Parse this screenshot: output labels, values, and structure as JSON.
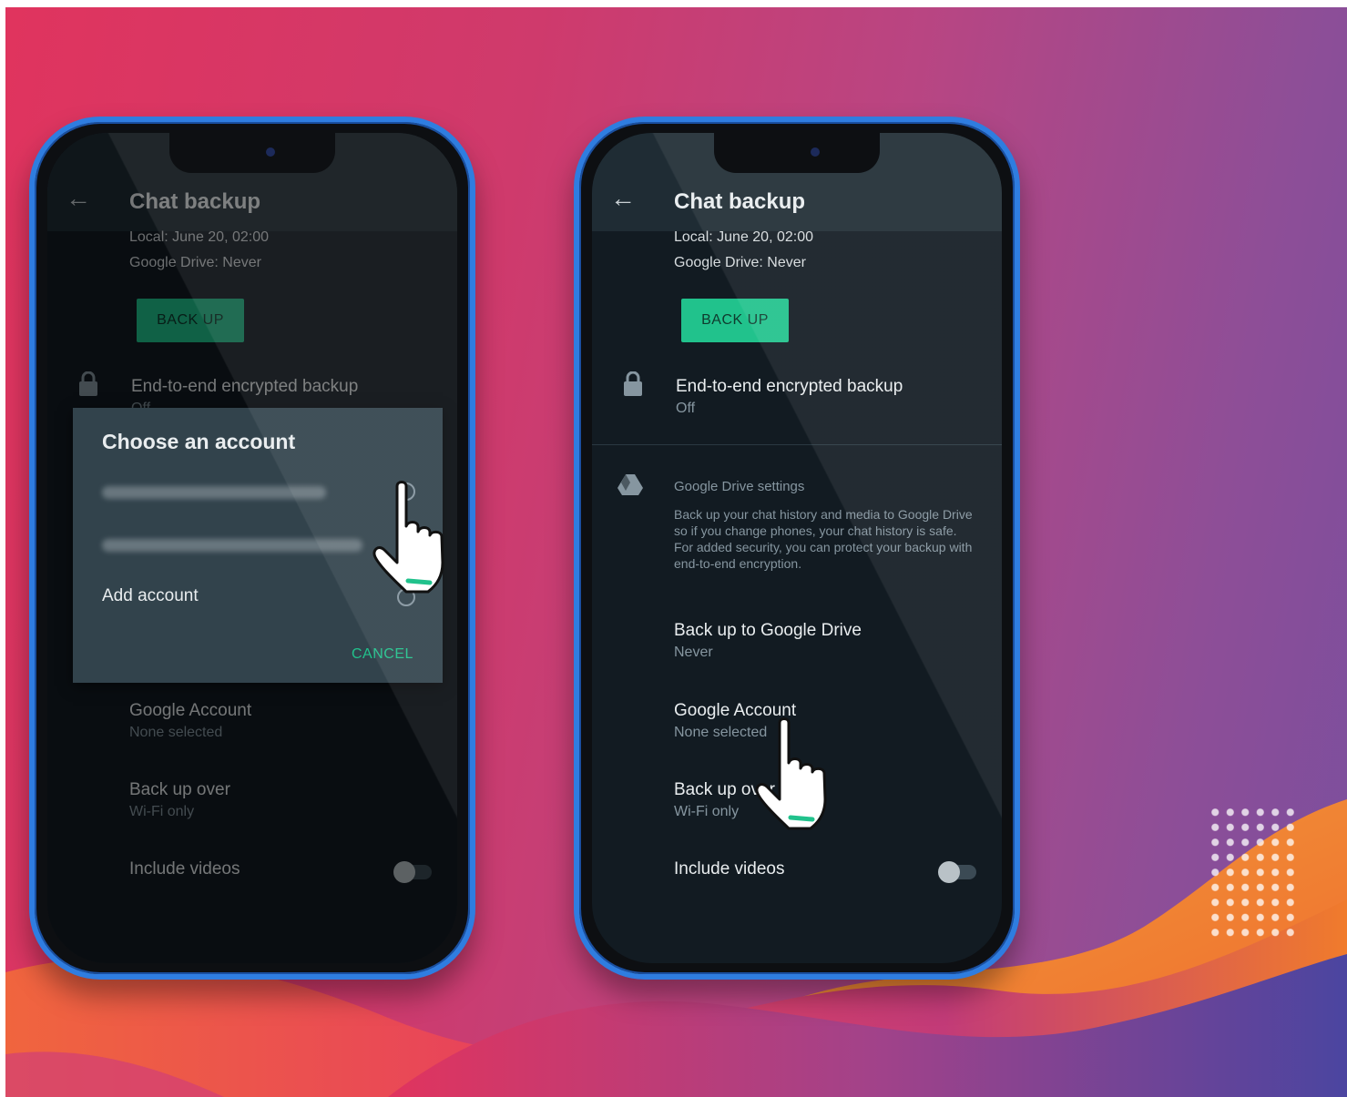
{
  "colors": {
    "accent": "#21c28c",
    "phone_frame": "#2f7de0",
    "screen_bg": "#121b22",
    "appbar_bg": "#1f2c34",
    "dialog_bg": "#32434c"
  },
  "left_phone": {
    "title": "Chat backup",
    "local": "Local: June 20, 02:00",
    "gdrive": "Google Drive: Never",
    "backup_button": "BACK UP",
    "e2e_label": "End-to-end encrypted backup",
    "e2e_value": "Off",
    "google_account_label": "Google Account",
    "google_account_value": "None selected",
    "backup_over_label": "Back up over",
    "backup_over_value": "Wi-Fi only",
    "include_videos": "Include videos",
    "dialog": {
      "title": "Choose an account",
      "add_account": "Add account",
      "cancel": "CANCEL"
    }
  },
  "right_phone": {
    "title": "Chat backup",
    "local": "Local: June 20, 02:00",
    "gdrive": "Google Drive: Never",
    "backup_button": "BACK UP",
    "e2e_label": "End-to-end encrypted backup",
    "e2e_value": "Off",
    "gdrive_section": "Google Drive settings",
    "gdrive_desc": "Back up your chat history and media to Google Drive so if you change phones, your chat history is safe. For added security, you can protect your backup with end-to-end encryption.",
    "backup_to_drive_label": "Back up to Google Drive",
    "backup_to_drive_value": "Never",
    "google_account_label": "Google Account",
    "google_account_value": "None selected",
    "backup_over_label": "Back up over",
    "backup_over_value": "Wi-Fi only",
    "include_videos": "Include videos"
  },
  "icons": {
    "back": "arrow-left-icon",
    "lock": "lock-icon",
    "drive": "google-drive-icon",
    "hand": "pointing-hand-icon"
  }
}
